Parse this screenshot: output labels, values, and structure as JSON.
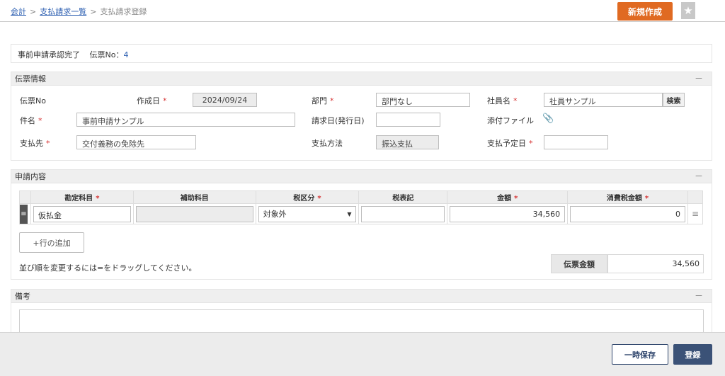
{
  "breadcrumb": {
    "items": [
      "会計",
      "支払請求一覧",
      "支払請求登録"
    ],
    "separator": ">"
  },
  "header": {
    "new_button": "新規作成",
    "star_icon": "star-icon"
  },
  "status": {
    "text": "事前申請承認完了",
    "voucher_label": "伝票No：",
    "voucher_no": "4"
  },
  "voucher_info": {
    "title": "伝票情報",
    "collapse": "－",
    "required_mark": "*",
    "voucher_no_label": "伝票No",
    "created_date_label": "作成日",
    "created_date": "2024/09/24",
    "department_label": "部門",
    "department": "部門なし",
    "employee_label": "社員名",
    "employee": "社員サンプル",
    "search_button": "検索",
    "subject_label": "件名",
    "subject": "事前申請サンプル",
    "invoice_date_label": "請求日(発行日)",
    "invoice_date": "",
    "attachment_label": "添付ファイル",
    "attachment_icon": "paperclip-icon",
    "payee_label": "支払先",
    "payee": "交付義務の免除先",
    "payment_method_label": "支払方法",
    "payment_method": "振込支払",
    "payment_due_label": "支払予定日",
    "payment_due": ""
  },
  "request": {
    "title": "申請内容",
    "collapse": "－",
    "columns": {
      "account": "勘定科目",
      "sub_account": "補助科目",
      "tax_type": "税区分",
      "tax_note": "税表記",
      "amount": "金額",
      "tax_amount": "消費税金額"
    },
    "rows": [
      {
        "handle": "≡",
        "account": "仮払金",
        "sub_account": "",
        "tax_type": "対象外",
        "tax_note": "",
        "amount": "34,560",
        "tax_amount": "0",
        "menu": "≡"
      }
    ],
    "add_row_button": "+行の追加",
    "reorder_hint": "並び順を変更するには=をドラッグしてください。",
    "total_label": "伝票金額",
    "total_value": "34,560"
  },
  "notes": {
    "title": "備考",
    "collapse": "－"
  },
  "footer": {
    "save_temp": "一時保存",
    "register": "登録"
  },
  "colors": {
    "accent_orange": "#e06a22",
    "primary_navy": "#3b5277",
    "link_blue": "#2a5db0",
    "required_red": "#d63333"
  }
}
